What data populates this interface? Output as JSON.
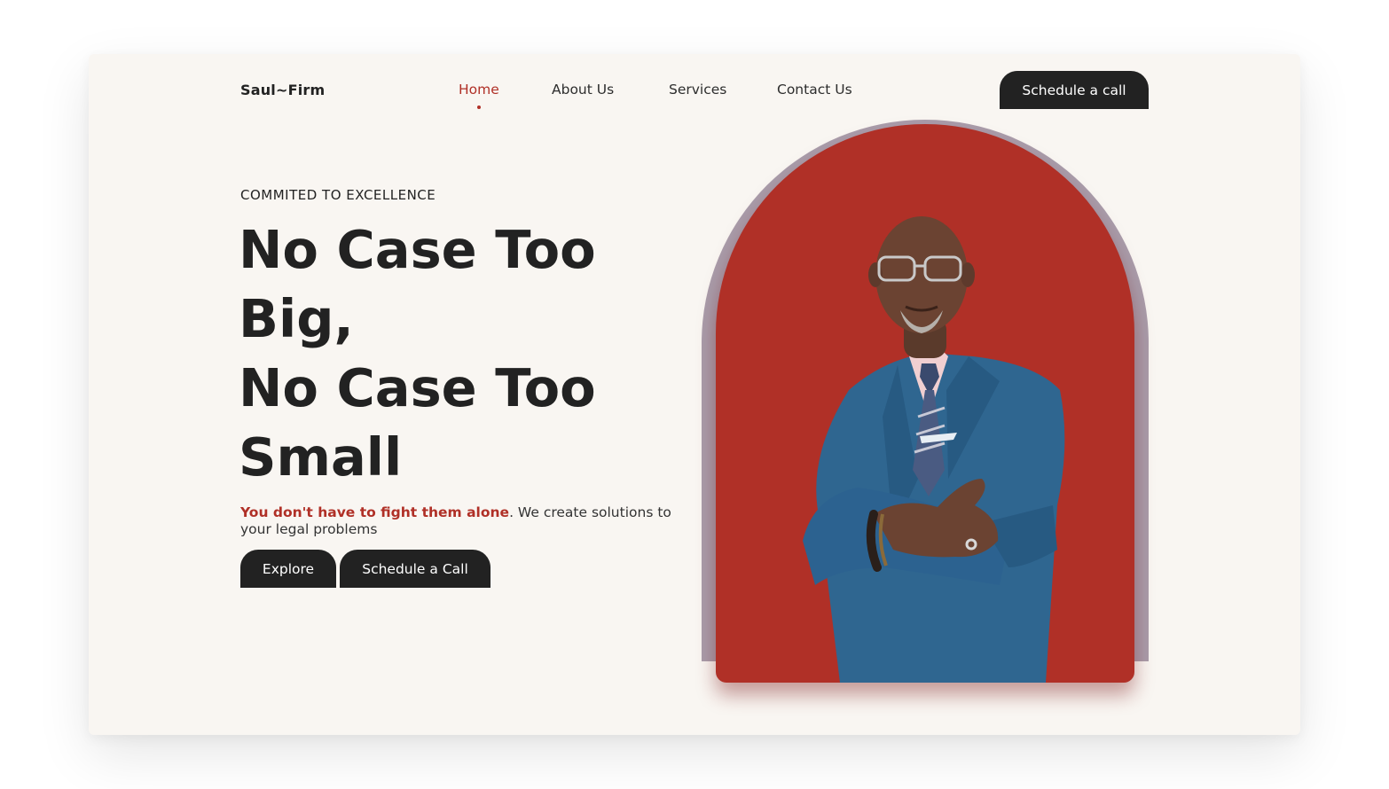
{
  "brand": {
    "logo": "Saul~Firm"
  },
  "nav": {
    "items": [
      {
        "label": "Home",
        "active": true
      },
      {
        "label": "About Us",
        "active": false
      },
      {
        "label": "Services",
        "active": false
      },
      {
        "label": "Contact Us",
        "active": false
      }
    ],
    "cta_label": "Schedule a call"
  },
  "hero": {
    "eyebrow": "COMMITED TO EXCELLENCE",
    "headline_lines": [
      "No Case Too",
      "Big,",
      "No Case Too",
      "Small"
    ],
    "sub_accent": "You don't have to fight them alone",
    "sub_rest": ". We create solutions to your legal problems",
    "buttons": {
      "explore": "Explore",
      "schedule": "Schedule a Call"
    },
    "image": {
      "subject": "lawyer-portrait",
      "icon": "person-in-suit-photo"
    }
  },
  "colors": {
    "accent": "#b03027",
    "dark": "#222222",
    "background": "#f9f6f2",
    "arch_shadow": "#a99dab",
    "suit": "#2f6690"
  }
}
